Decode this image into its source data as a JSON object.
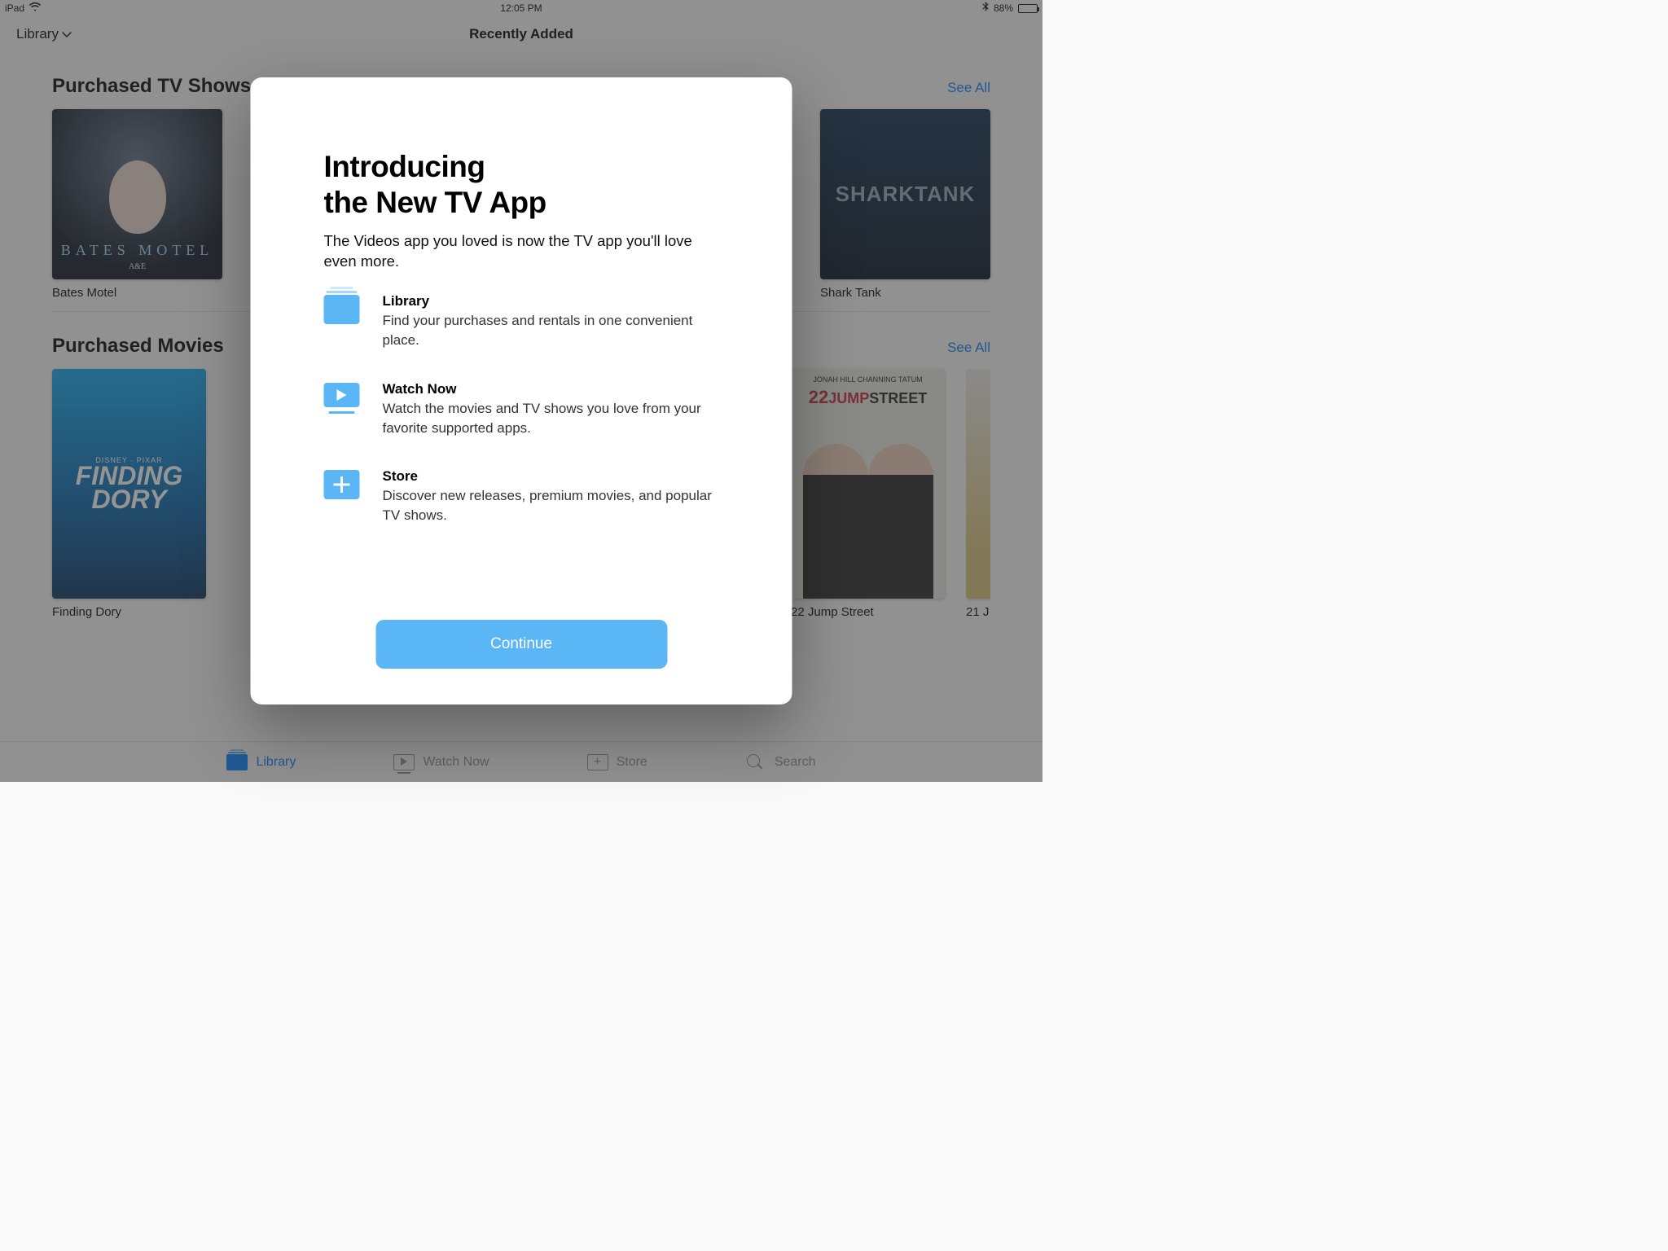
{
  "statusbar": {
    "device": "iPad",
    "time": "12:05 PM",
    "battery_pct": "88%"
  },
  "navbar": {
    "library_label": "Library",
    "title": "Recently Added"
  },
  "sections": {
    "tv": {
      "title": "Purchased TV Shows",
      "see_all": "See All",
      "items": [
        {
          "title": "Bates Motel"
        },
        {
          "title": "Shark Tank"
        }
      ]
    },
    "movies": {
      "title": "Purchased Movies",
      "see_all": "See All",
      "items": [
        {
          "title": "Finding Dory"
        },
        {
          "title": "22 Jump Street"
        },
        {
          "title": "21 J"
        }
      ]
    }
  },
  "tabs": {
    "library": "Library",
    "watch_now": "Watch Now",
    "store": "Store",
    "search": "Search"
  },
  "modal": {
    "title_l1": "Introducing",
    "title_l2": "the New TV App",
    "subtitle": "The Videos app you loved is now the TV app you'll love even more.",
    "features": [
      {
        "title": "Library",
        "desc": "Find your purchases and rentals in one convenient place."
      },
      {
        "title": "Watch Now",
        "desc": "Watch the movies and TV shows you love from your favorite supported apps."
      },
      {
        "title": "Store",
        "desc": "Discover new releases, premium movies, and popular TV shows."
      }
    ],
    "continue": "Continue"
  },
  "poster_text": {
    "bates_title": "BATES MOTEL",
    "bates_net": "A&E",
    "dory_small": "DISNEY · PIXAR",
    "dory_l1": "FINDING",
    "dory_l2": "DORY",
    "jump_top": "JONAH HILL   CHANNING TATUM",
    "jump_n": "22",
    "jump_j": "JUMP",
    "jump_s": "STREET",
    "shark_a": "SHARK",
    "shark_b": "TANK"
  }
}
